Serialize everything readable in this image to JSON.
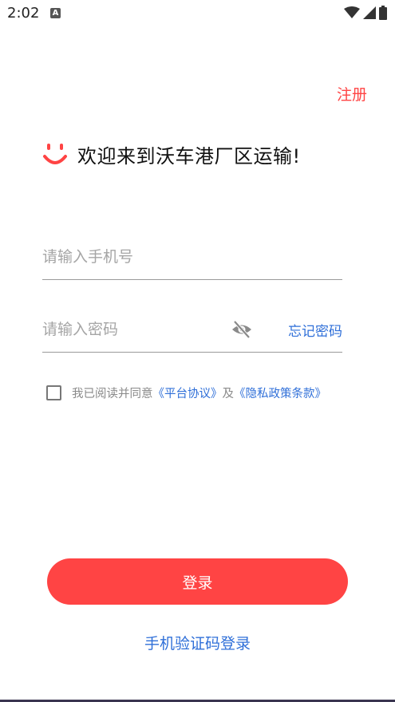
{
  "status_bar": {
    "time": "2:02",
    "app_icon_letter": "A",
    "icons": [
      "wifi-icon",
      "signal-icon",
      "battery-icon"
    ]
  },
  "header": {
    "register_label": "注册"
  },
  "welcome": {
    "icon": "smile-icon",
    "text": "欢迎来到沃车港厂区运输!"
  },
  "form": {
    "phone_placeholder": "请输入手机号",
    "phone_value": "",
    "password_placeholder": "请输入密码",
    "password_value": "",
    "visibility_icon": "eye-off-icon",
    "forgot_label": "忘记密码"
  },
  "agreement": {
    "checked": false,
    "prefix": "我已阅读并同意",
    "platform_link": "《平台协议》",
    "conjunction": "及",
    "privacy_link": "《隐私政策条款》"
  },
  "actions": {
    "login_label": "登录",
    "sms_login_label": "手机验证码登录"
  },
  "colors": {
    "accent": "#ff4444",
    "link": "#2f6fd8",
    "placeholder": "#a5a5a5"
  }
}
